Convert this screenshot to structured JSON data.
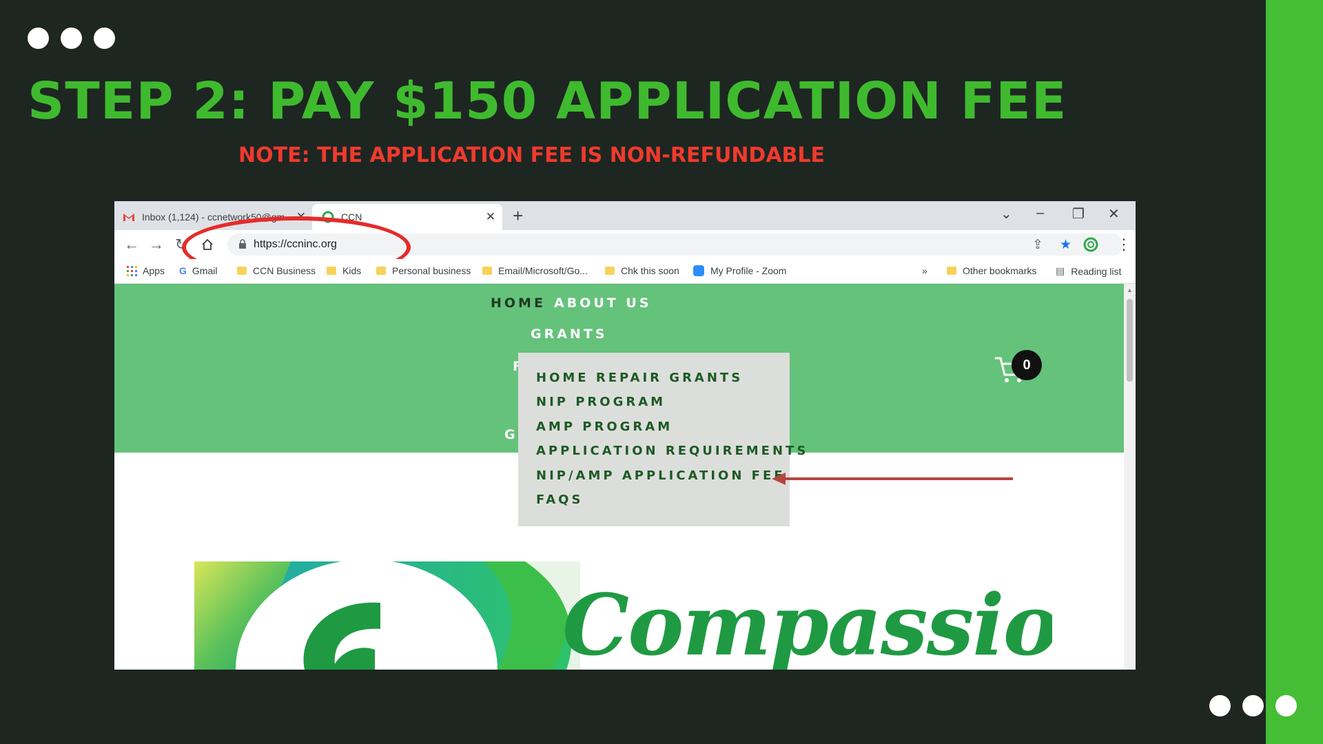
{
  "slide": {
    "title": "STEP 2: PAY $150 APPLICATION FEE",
    "note": "NOTE: THE APPLICATION FEE IS NON-REFUNDABLE",
    "colors": {
      "background": "#1e2622",
      "title": "#3fba2e",
      "note": "#ef3a2d",
      "band": "#45bd35"
    }
  },
  "browser": {
    "tabs": [
      {
        "label": "Inbox (1,124) - ccnetwork50@gm",
        "icon": "gmail-icon"
      },
      {
        "label": "CCN",
        "icon": "ccn-favicon-icon",
        "active": true
      }
    ],
    "url": "https://ccninc.org",
    "bookmarks": [
      {
        "label": "Apps",
        "icon": "apps-grid-icon"
      },
      {
        "label": "Gmail",
        "icon": "google-icon"
      },
      {
        "label": "CCN Business",
        "icon": "folder-icon"
      },
      {
        "label": "Kids",
        "icon": "folder-icon"
      },
      {
        "label": "Personal business",
        "icon": "folder-icon"
      },
      {
        "label": "Email/Microsoft/Go...",
        "icon": "folder-icon"
      },
      {
        "label": "Chk this soon",
        "icon": "folder-icon"
      },
      {
        "label": "My Profile - Zoom",
        "icon": "zoom-icon"
      }
    ],
    "bookmarks_overflow": "»",
    "other_bookmarks": "Other bookmarks",
    "reading_list": "Reading list"
  },
  "site": {
    "nav": {
      "home": "HOME",
      "about": "ABOUT US",
      "grants": "GRANTS",
      "cut_f": "F",
      "cut_g": "G"
    },
    "dropdown": [
      "HOME REPAIR GRANTS",
      "NIP PROGRAM",
      "AMP PROGRAM",
      "APPLICATION REQUIREMENTS",
      "NIP/AMP APPLICATION FEE",
      "FAQS"
    ],
    "cart_count": "0",
    "brand_word": "Compassionate",
    "colors": {
      "header": "#65c27b",
      "dropdown": "#dcdedb",
      "dropdown_text": "#1d5a24",
      "arrow": "#b5463f"
    }
  }
}
